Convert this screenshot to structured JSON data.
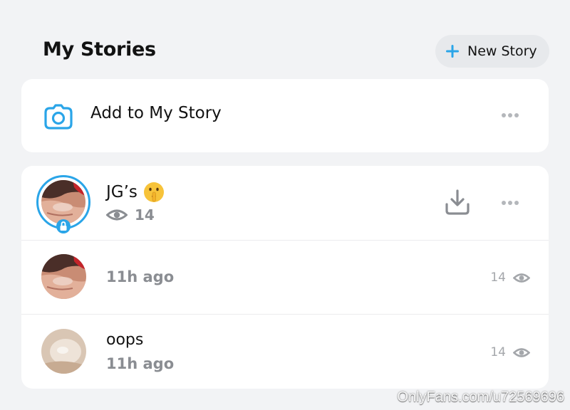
{
  "header": {
    "title": "My Stories",
    "new_story_label": "New Story"
  },
  "add_card": {
    "label": "Add to My Story"
  },
  "stories": {
    "main": {
      "name": "JG’s",
      "views": "14"
    },
    "snaps": [
      {
        "title": "",
        "time": "11h ago",
        "views": "14"
      },
      {
        "title": "oops",
        "time": "11h ago",
        "views": "14"
      }
    ]
  },
  "watermark": "OnlyFans.com/u72569696",
  "colors": {
    "accent_blue": "#2aa5e8",
    "muted_gray": "#8a8d92",
    "background": "#f2f3f5"
  },
  "icons": {
    "new_story": "plus-icon",
    "camera": "camera-icon",
    "more": "more-icon",
    "views": "eye-icon",
    "download": "download-icon",
    "lock": "lock-icon",
    "emoji": "shushing-face-emoji"
  }
}
